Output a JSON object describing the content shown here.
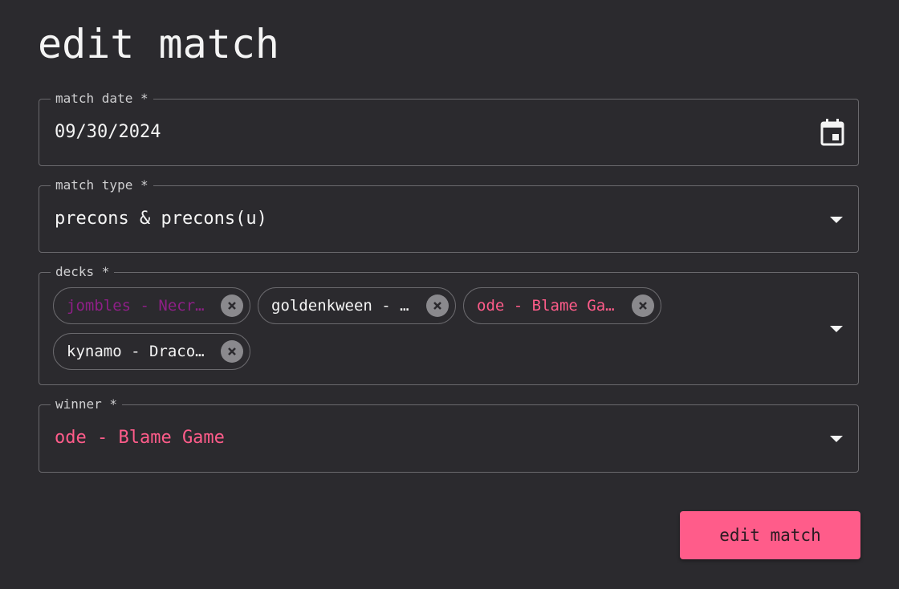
{
  "page": {
    "title": "edit match"
  },
  "form": {
    "match_date": {
      "label": "match date *",
      "value": "09/30/2024",
      "icon": "calendar-icon"
    },
    "match_type": {
      "label": "match type *",
      "value": "precons & precons(u)"
    },
    "decks": {
      "label": "decks *",
      "chips": [
        {
          "label": "jombles - Necr…",
          "color": "#8e1f87"
        },
        {
          "label": "goldenkween - …",
          "color": "#f4f4f4"
        },
        {
          "label": "ode - Blame Ga…",
          "color": "#ff5c8a"
        },
        {
          "label": "kynamo - Draco…",
          "color": "#f4f4f4"
        }
      ]
    },
    "winner": {
      "label": "winner *",
      "value": "ode - Blame Game",
      "color": "#ff5c8a"
    }
  },
  "actions": {
    "submit_label": "edit match"
  },
  "colors": {
    "accent": "#ff5c8a",
    "background": "#2b2a2e",
    "border": "#6a696d"
  }
}
